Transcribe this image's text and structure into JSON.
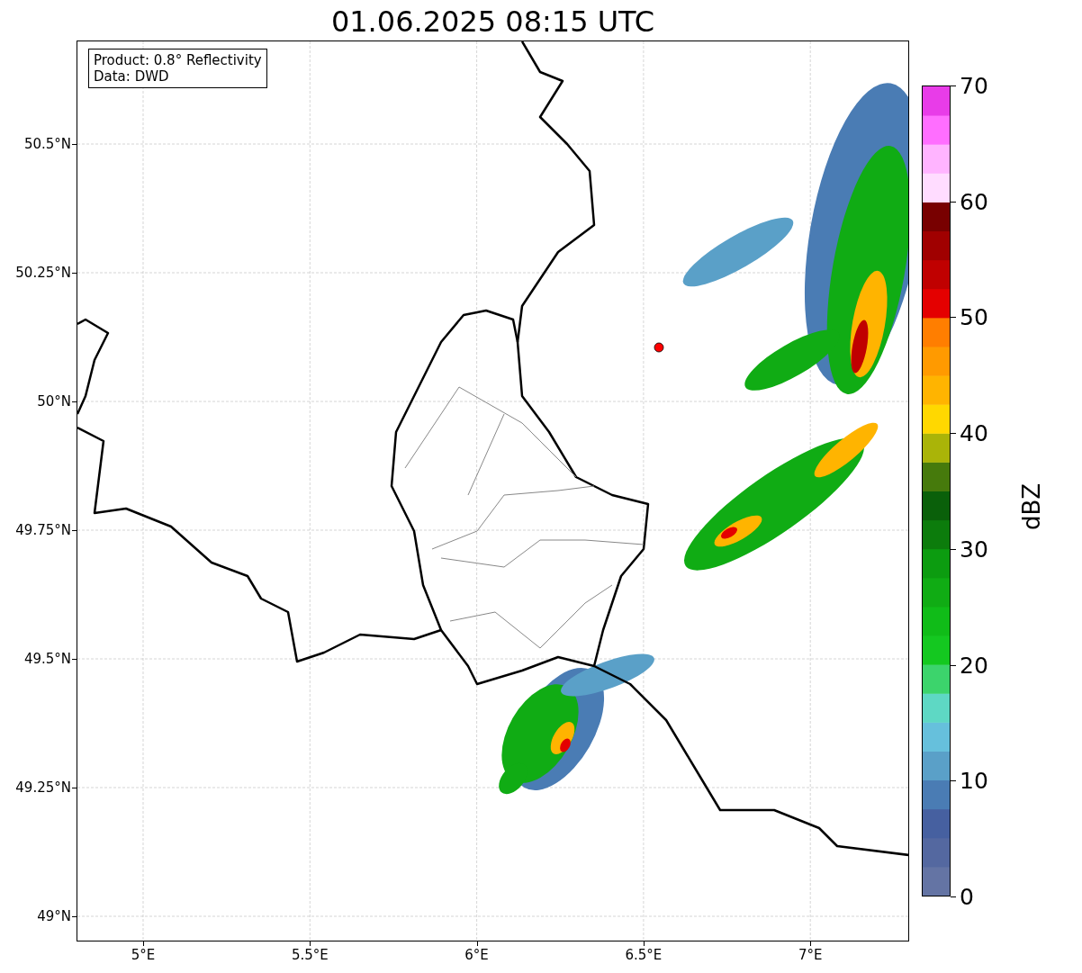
{
  "title": "01.06.2025 08:15 UTC",
  "legend": [
    "Product: 0.8° Reflectivity",
    "Data: DWD"
  ],
  "y_axis": {
    "ticks": [
      "50.5°N",
      "50.25°N",
      "50°N",
      "49.75°N",
      "49.5°N",
      "49.25°N",
      "49°N"
    ]
  },
  "x_axis": {
    "ticks": [
      "5°E",
      "5.5°E",
      "6°E",
      "6.5°E",
      "7°E"
    ]
  },
  "colorbar": {
    "label": "dBZ",
    "ticks": [
      "70",
      "60",
      "50",
      "40",
      "30",
      "20",
      "10",
      "0"
    ],
    "bins": [
      {
        "color": "#6474a4"
      },
      {
        "color": "#5468a0"
      },
      {
        "color": "#4660a0"
      },
      {
        "color": "#4a7cb4"
      },
      {
        "color": "#5aa0c8"
      },
      {
        "color": "#66c0dc"
      },
      {
        "color": "#5ed8c4"
      },
      {
        "color": "#3cd46c"
      },
      {
        "color": "#14c820"
      },
      {
        "color": "#10bc18"
      },
      {
        "color": "#10ac14"
      },
      {
        "color": "#0c9c10"
      },
      {
        "color": "#0c7c0c"
      },
      {
        "color": "#0a600a"
      },
      {
        "color": "#467a0c"
      },
      {
        "color": "#aab408"
      },
      {
        "color": "#ffd800"
      },
      {
        "color": "#ffb400"
      },
      {
        "color": "#ff9a00"
      },
      {
        "color": "#ff7e00"
      },
      {
        "color": "#e40000"
      },
      {
        "color": "#c00000"
      },
      {
        "color": "#a00000"
      },
      {
        "color": "#780000"
      },
      {
        "color": "#ffdcff"
      },
      {
        "color": "#ffb4ff"
      },
      {
        "color": "#ff6eff"
      },
      {
        "color": "#e83ce8"
      }
    ]
  }
}
